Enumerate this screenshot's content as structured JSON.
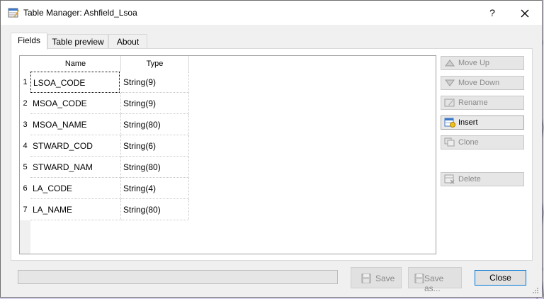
{
  "window": {
    "title": "Table Manager: Ashfield_Lsoa",
    "help_label": "?"
  },
  "tabs": [
    {
      "label": "Fields",
      "active": true
    },
    {
      "label": "Table preview",
      "active": false
    },
    {
      "label": "About",
      "active": false
    }
  ],
  "table": {
    "headers": [
      "Name",
      "Type"
    ],
    "rows": [
      {
        "num": "1",
        "name": "LSOA_CODE",
        "type": "String(9)"
      },
      {
        "num": "2",
        "name": "MSOA_CODE",
        "type": "String(9)"
      },
      {
        "num": "3",
        "name": "MSOA_NAME",
        "type": "String(80)"
      },
      {
        "num": "4",
        "name": "STWARD_COD",
        "type": "String(6)"
      },
      {
        "num": "5",
        "name": "STWARD_NAM",
        "type": "String(80)"
      },
      {
        "num": "6",
        "name": "LA_CODE",
        "type": "String(4)"
      },
      {
        "num": "7",
        "name": "LA_NAME",
        "type": "String(80)"
      }
    ]
  },
  "side_buttons": [
    {
      "label": "Move Up",
      "enabled": false
    },
    {
      "label": "Move Down",
      "enabled": false
    },
    {
      "label": "Rename",
      "enabled": false
    },
    {
      "label": "Insert",
      "enabled": true
    },
    {
      "label": "Clone",
      "enabled": false
    },
    {
      "label": "Delete",
      "enabled": false
    }
  ],
  "bottom": {
    "save_label": "Save",
    "save_as_label": "Save as...",
    "close_label": "Close"
  },
  "colors": {
    "focus_border": "#0078d7",
    "disabled_text": "#8a8a8a"
  }
}
